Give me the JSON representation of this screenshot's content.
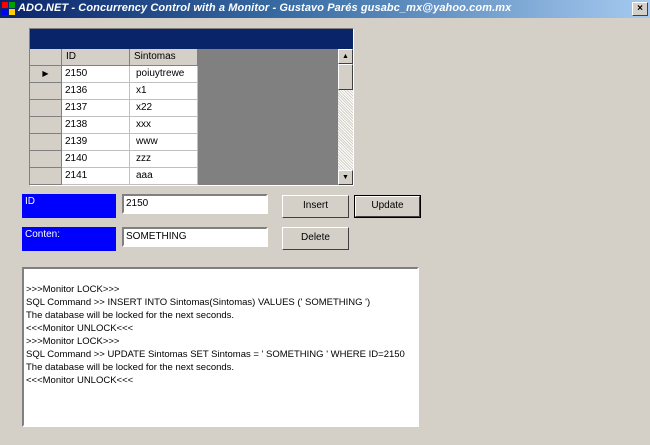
{
  "window": {
    "title": "ADO.NET - Concurrency Control with a Monitor - Gustavo Parés gusabc_mx@yahoo.com.mx",
    "close_glyph": "×"
  },
  "grid": {
    "columns": [
      "ID",
      "Sintomas"
    ],
    "current_row_marker": "▶",
    "rows": [
      {
        "id": "2150",
        "sintomas": "poiuytrewe"
      },
      {
        "id": "2136",
        "sintomas": "x1"
      },
      {
        "id": "2137",
        "sintomas": "x22"
      },
      {
        "id": "2138",
        "sintomas": "xxx"
      },
      {
        "id": "2139",
        "sintomas": "www"
      },
      {
        "id": "2140",
        "sintomas": "zzz"
      },
      {
        "id": "2141",
        "sintomas": "aaa"
      }
    ],
    "scroll_up": "▲",
    "scroll_down": "▼"
  },
  "form": {
    "id_label": "ID",
    "id_value": "2150",
    "content_label": "Conten:",
    "content_value": "SOMETHING",
    "insert_button": "Insert",
    "update_button": "Update",
    "delete_button": "Delete"
  },
  "log": {
    "lines": [
      ">>>Monitor LOCK>>>",
      "SQL Command >> INSERT INTO Sintomas(Sintomas) VALUES (' SOMETHING ')",
      "The database will be locked for the next seconds.",
      "<<<Monitor UNLOCK<<<",
      ">>>Monitor LOCK>>>",
      "SQL Command >> UPDATE Sintomas SET Sintomas = ' SOMETHING ' WHERE ID=2150",
      "The database will be locked for the next seconds.",
      "<<<Monitor UNLOCK<<<"
    ]
  },
  "colors": {
    "caption": "#0a246a",
    "label_bg": "#0000ff",
    "face": "#d4d0c8"
  }
}
